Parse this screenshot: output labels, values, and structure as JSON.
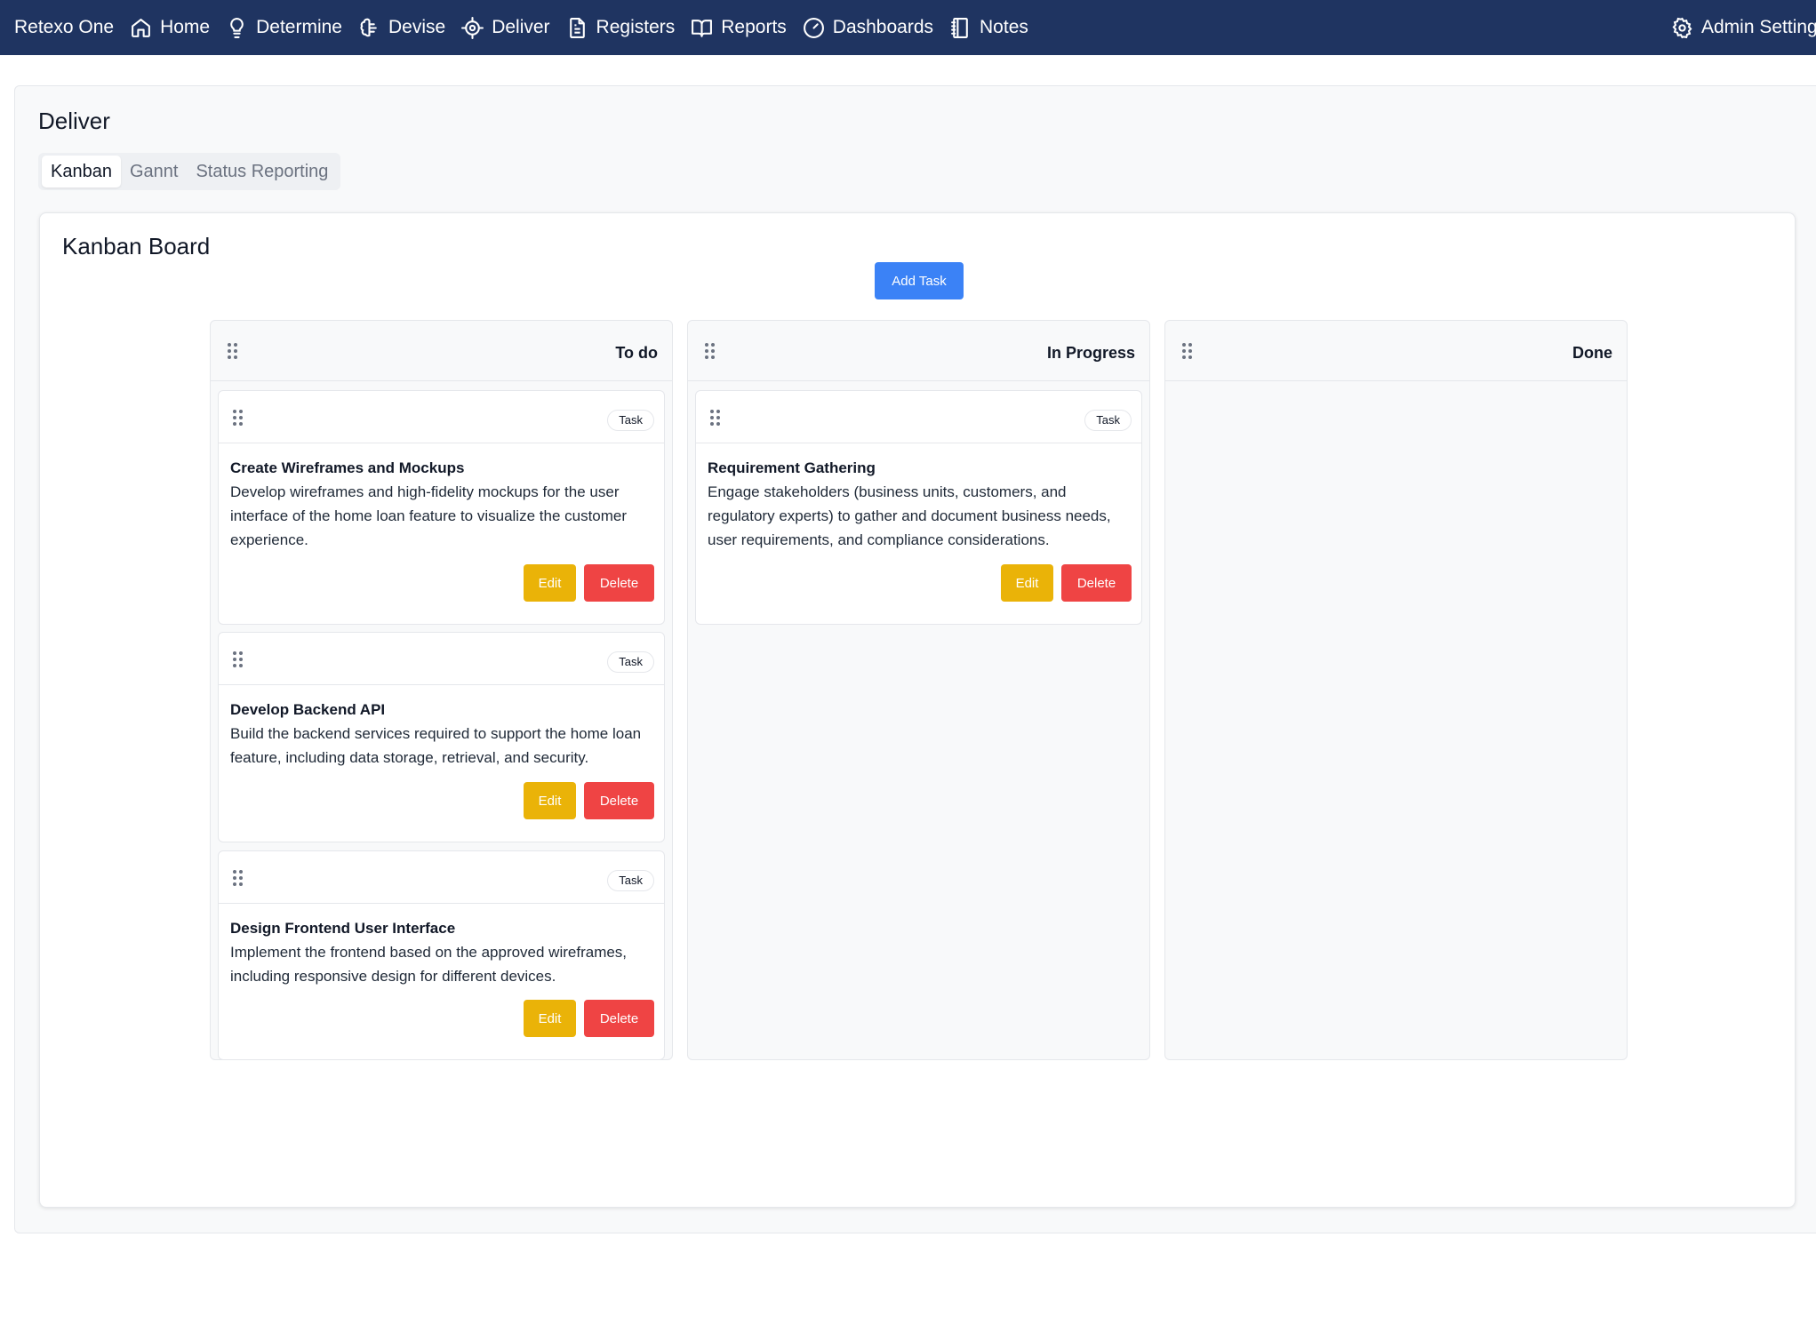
{
  "nav": {
    "brand": "Retexo One",
    "items": [
      {
        "label": "Home",
        "icon": "home-icon"
      },
      {
        "label": "Determine",
        "icon": "lightbulb-icon"
      },
      {
        "label": "Devise",
        "icon": "brain-icon"
      },
      {
        "label": "Deliver",
        "icon": "target-icon"
      },
      {
        "label": "Registers",
        "icon": "document-icon"
      },
      {
        "label": "Reports",
        "icon": "book-open-icon"
      },
      {
        "label": "Dashboards",
        "icon": "gauge-icon"
      },
      {
        "label": "Notes",
        "icon": "notebook-icon"
      }
    ],
    "admin": {
      "label": "Admin Settings",
      "icon": "gear-icon"
    }
  },
  "page": {
    "title": "Deliver",
    "tabs": [
      {
        "label": "Kanban",
        "active": true
      },
      {
        "label": "Gannt",
        "active": false
      },
      {
        "label": "Status Reporting",
        "active": false
      }
    ]
  },
  "board": {
    "title": "Kanban Board",
    "add_label": "Add Task",
    "edit_label": "Edit",
    "delete_label": "Delete",
    "columns": [
      {
        "title": "To do",
        "cards": [
          {
            "badge": "Task",
            "title": "Create Wireframes and Mockups",
            "description": "Develop wireframes and high-fidelity mockups for the user interface of the home loan feature to visualize the customer experience."
          },
          {
            "badge": "Task",
            "title": "Develop Backend API",
            "description": "Build the backend services required to support the home loan feature, including data storage, retrieval, and security."
          },
          {
            "badge": "Task",
            "title": "Design Frontend User Interface",
            "description": "Implement the frontend based on the approved wireframes, including responsive design for different devices."
          }
        ]
      },
      {
        "title": "In Progress",
        "cards": [
          {
            "badge": "Task",
            "title": "Requirement Gathering",
            "description": "Engage stakeholders (business units, customers, and regulatory experts) to gather and document business needs, user requirements, and compliance considerations."
          }
        ]
      },
      {
        "title": "Done",
        "cards": []
      }
    ]
  },
  "colors": {
    "nav_bg": "#1f3461",
    "primary": "#3b82f6",
    "edit": "#eab308",
    "delete": "#ef4444"
  }
}
